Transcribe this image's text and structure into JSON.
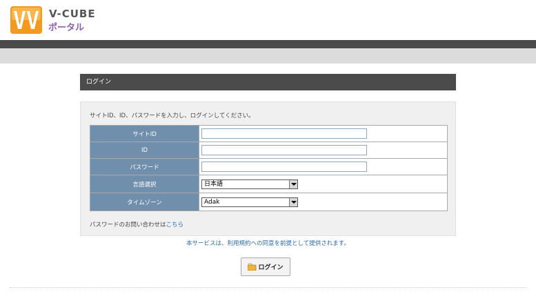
{
  "brand": {
    "name": "V-CUBE",
    "subtitle": "ポータル",
    "colors": {
      "logo_orange": "#f39a1e",
      "logo_purple": "#8a5fb0"
    }
  },
  "login_panel": {
    "title": "ログイン",
    "instruction": "サイトID、ID、パスワードを入力し、ログインしてください。",
    "fields": {
      "site_id": {
        "label": "サイトID",
        "value": ""
      },
      "user_id": {
        "label": "ID",
        "value": ""
      },
      "password": {
        "label": "パスワード",
        "value": ""
      },
      "language": {
        "label": "言語選択",
        "selected": "日本語"
      },
      "timezone": {
        "label": "タイムゾーン",
        "selected": "Adak"
      }
    },
    "inquiry_prefix": "パスワードのお問い合わせは",
    "inquiry_link": "こちら"
  },
  "terms_text": "本サービスは、利用規約への同意を前提として提供されます。",
  "login_button": {
    "label": "ログイン",
    "icon": "key-icon"
  }
}
